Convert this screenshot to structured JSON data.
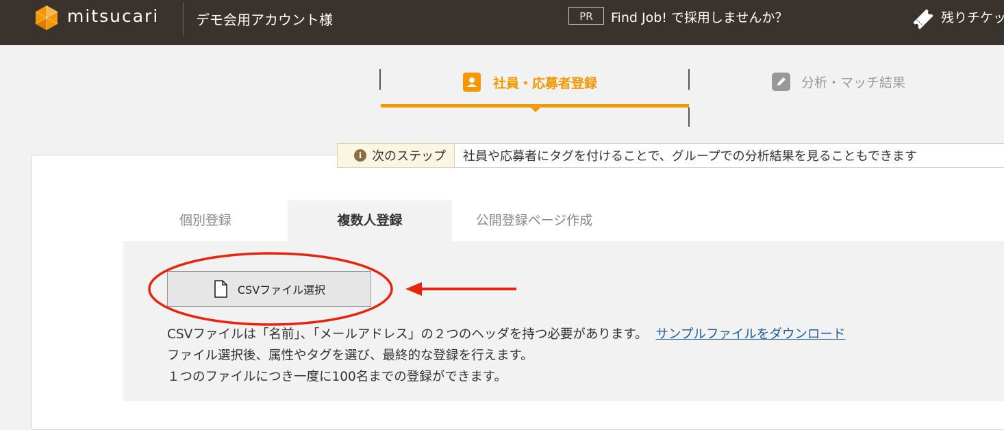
{
  "header": {
    "logo_text": "mitsucari",
    "account_name": "デモ会用アカウント様",
    "pr_badge": "PR",
    "pr_link": "Find Job! で採用しませんか？",
    "ticket_text": "残りチケット"
  },
  "steps": {
    "active_label": "社員・応募者登録",
    "inactive_label": "分析・マッチ結果"
  },
  "notice": {
    "label": "次のステップ",
    "text": "社員や応募者にタグを付けることで、グループでの分析結果を見ることもできます"
  },
  "tabs": [
    {
      "label": "個別登録"
    },
    {
      "label": "複数人登録"
    },
    {
      "label": "公開登録ページ作成"
    }
  ],
  "csv": {
    "button_label": "CSVファイル選択",
    "desc_line1": "CSVファイルは「名前」、「メールアドレス」の２つのヘッダを持つ必要があります。",
    "sample_link": "サンプルファイルをダウンロード",
    "desc_line2": "ファイル選択後、属性やタグを選び、最終的な登録を行えます。",
    "desc_line3": "１つのファイルにつき一度に100名までの登録ができます。"
  },
  "colors": {
    "header_bg": "#3a322c",
    "accent": "#f39800",
    "annotation": "#e8250c",
    "link": "#1f5fa0"
  }
}
